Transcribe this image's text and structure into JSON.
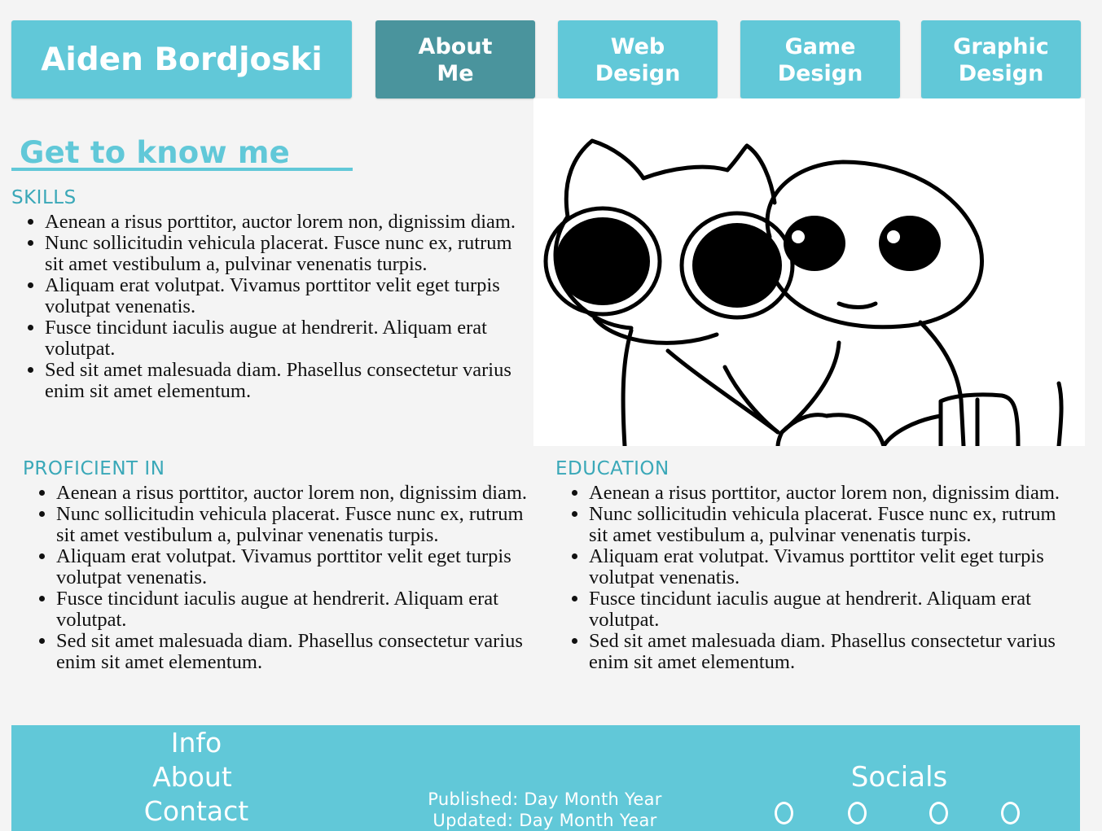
{
  "header": {
    "brand": "Aiden Bordjoski",
    "nav": [
      {
        "label": "About\nMe",
        "active": true
      },
      {
        "label": "Web\nDesign",
        "active": false
      },
      {
        "label": "Game\nDesign",
        "active": false
      },
      {
        "label": "Graphic\nDesign",
        "active": false
      }
    ]
  },
  "main": {
    "title": "Get to know me",
    "skills": {
      "heading": "SKILLS",
      "items": [
        "Aenean a risus porttitor, auctor lorem non, dignissim diam.",
        "Nunc sollicitudin vehicula placerat. Fusce nunc ex, rutrum sit amet vestibulum a, pulvinar venenatis turpis.",
        "Aliquam erat volutpat. Vivamus porttitor velit eget turpis volutpat venenatis.",
        "Fusce tincidunt iaculis augue at hendrerit. Aliquam erat volutpat.",
        "Sed sit amet malesuada diam. Phasellus consectetur varius enim sit amet elementum."
      ]
    },
    "proficient": {
      "heading": "PROFICIENT IN",
      "items": [
        "Aenean a risus porttitor, auctor lorem non, dignissim diam.",
        "Nunc sollicitudin vehicula placerat. Fusce nunc ex, rutrum sit amet vestibulum a, pulvinar venenatis turpis.",
        "Aliquam erat volutpat. Vivamus porttitor velit eget turpis volutpat venenatis.",
        "Fusce tincidunt iaculis augue at hendrerit. Aliquam erat volutpat.",
        "Sed sit amet malesuada diam. Phasellus consectetur varius enim sit amet elementum."
      ]
    },
    "education": {
      "heading": "EDUCATION",
      "items": [
        "Aenean a risus porttitor, auctor lorem non, dignissim diam.",
        "Nunc sollicitudin vehicula placerat. Fusce nunc ex, rutrum sit amet vestibulum a, pulvinar venenatis turpis.",
        "Aliquam erat volutpat. Vivamus porttitor velit eget turpis volutpat venenatis.",
        "Fusce tincidunt iaculis augue at hendrerit. Aliquam erat volutpat.",
        "Sed sit amet malesuada diam. Phasellus consectetur varius enim sit amet elementum."
      ]
    }
  },
  "footer": {
    "links": [
      "Info",
      "About",
      "Contact"
    ],
    "published": "Published: Day Month Year",
    "updated": "Updated: Day Month Year",
    "socials_title": "Socials",
    "social_icons": [
      "social-link-1",
      "social-link-2",
      "social-link-3",
      "social-link-4"
    ]
  },
  "colors": {
    "accent": "#61c8d8",
    "accent_active": "#4a949d",
    "heading": "#3aa8b8",
    "background": "#f4f4f4"
  }
}
